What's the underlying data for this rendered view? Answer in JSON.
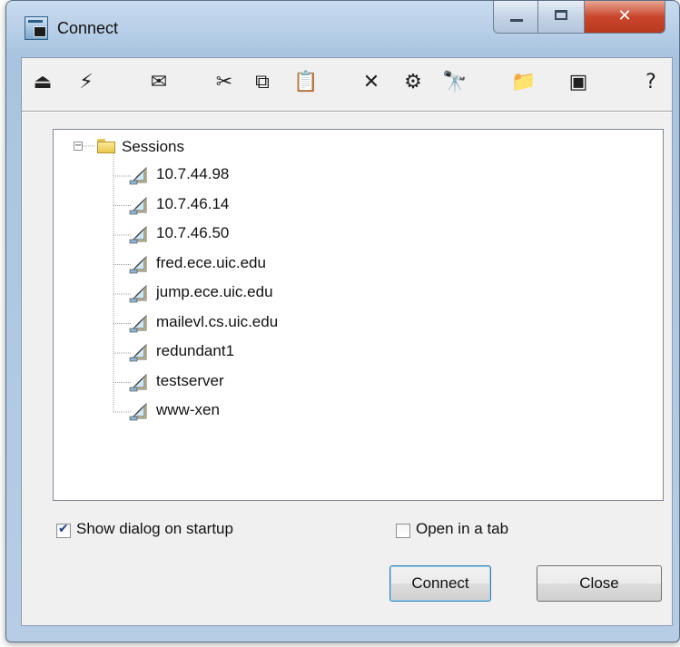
{
  "window": {
    "title": "Connect",
    "icon": "connect-window-icon",
    "caption_buttons": {
      "minimize": "minimize-icon",
      "maximize": "maximize-icon",
      "close": "close-icon"
    }
  },
  "toolbar": {
    "buttons": [
      {
        "name": "connect-icon",
        "glyph": "⏏"
      },
      {
        "name": "quick-connect-icon",
        "glyph": "⚡"
      },
      {
        "name": "new-session-icon",
        "glyph": "✉"
      },
      {
        "name": "cut-icon",
        "glyph": "✂"
      },
      {
        "name": "copy-icon",
        "glyph": "⧉"
      },
      {
        "name": "paste-icon",
        "glyph": "📋"
      },
      {
        "name": "delete-icon",
        "glyph": "✕"
      },
      {
        "name": "properties-icon",
        "glyph": "⚙"
      },
      {
        "name": "find-icon",
        "glyph": "🔭"
      },
      {
        "name": "new-folder-icon",
        "glyph": "📁"
      },
      {
        "name": "terminal-icon",
        "glyph": "▣"
      },
      {
        "name": "help-icon",
        "glyph": "?"
      }
    ]
  },
  "tree": {
    "root_label": "Sessions",
    "expander": "−",
    "sessions": [
      "10.7.44.98",
      "10.7.46.14",
      "10.7.46.50",
      "fred.ece.uic.edu",
      "jump.ece.uic.edu",
      "mailevl.cs.uic.edu",
      "redundant1",
      "testserver",
      "www-xen"
    ]
  },
  "options": {
    "show_dialog_on_startup": {
      "label": "Show dialog on startup",
      "checked": true
    },
    "open_in_tab": {
      "label": "Open in a tab",
      "checked": false
    }
  },
  "buttons": {
    "connect": "Connect",
    "close": "Close"
  },
  "colors": {
    "close_button": "#c9462c",
    "frame": "#a9c4e0",
    "default_button_border": "#3c7fb1"
  }
}
